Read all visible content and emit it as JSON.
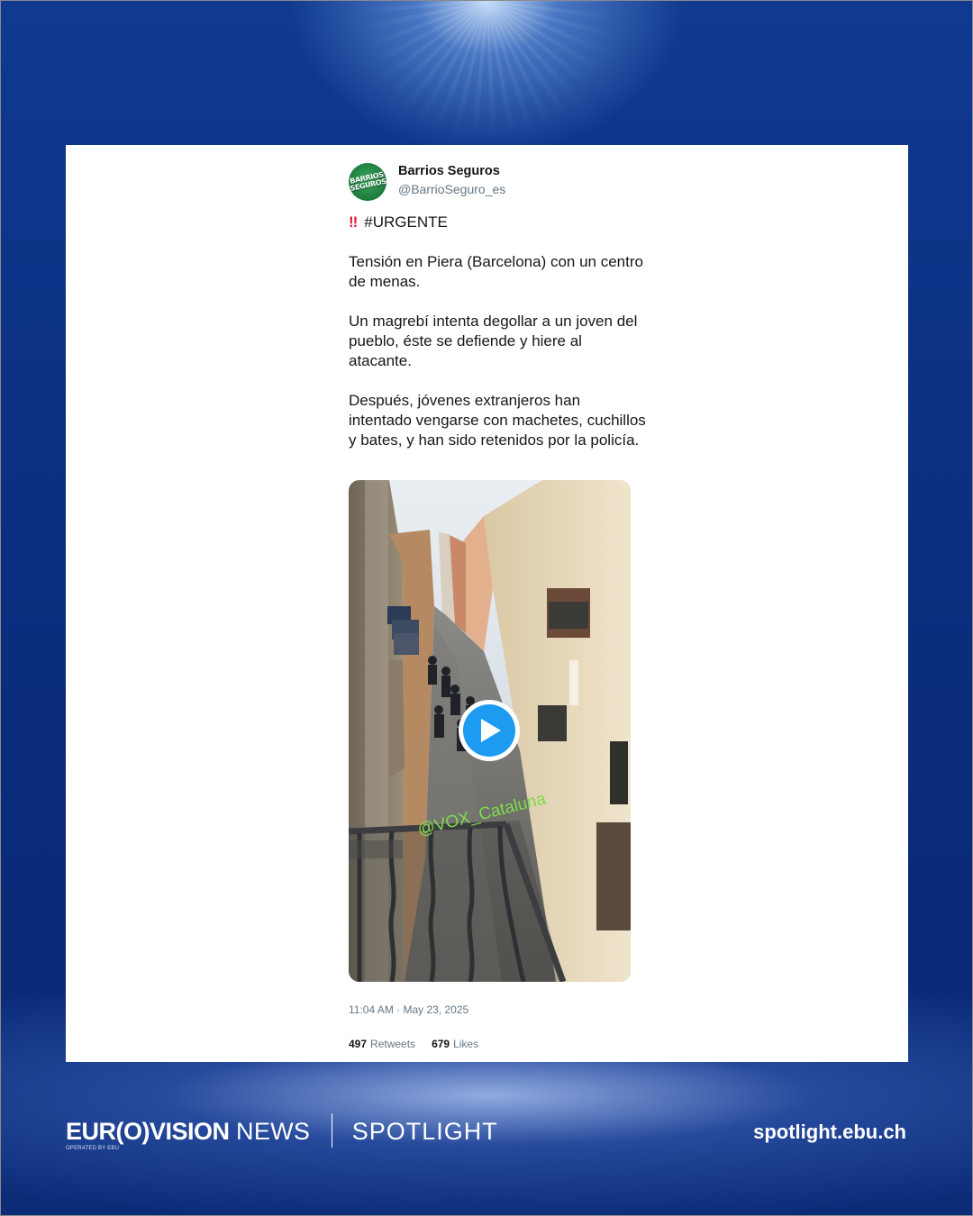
{
  "tweet": {
    "display_name": "Barrios Seguros",
    "handle": "@BarrioSeguro_es",
    "avatar_text": "BARRIOS SEGUROS",
    "urgent_marker": "‼",
    "hashtag": "#URGENTE",
    "body_text": "Tensión en Piera (Barcelona) con un centro de menas.\n\nUn magrebí intenta degollar a un joven del pueblo, éste se defiende y hiere al atacante.\n\nDespués, jóvenes extranjeros han intentado vengarse con machetes, cuchillos y bates, y han sido retenidos por la policía.",
    "video_watermark": "@VOX_Cataluna",
    "timestamp": "11:04 AM · May 23, 2025",
    "retweets_count": "497",
    "retweets_label": "Retweets",
    "likes_count": "679",
    "likes_label": "Likes"
  },
  "footer": {
    "brand_bold": "EUR(O)VISION",
    "brand_regular": "NEWS",
    "section": "SPOTLIGHT",
    "operated_by": "OPERATED BY EBU",
    "url": "spotlight.ebu.ch"
  },
  "icons": {
    "play": "play-icon",
    "urgent": "double-exclamation-icon"
  },
  "colors": {
    "background_blue": "#0c2f82",
    "play_button": "#1d9bf0",
    "watermark_green": "#7ddc4a",
    "urgent_red": "#d9203a"
  }
}
